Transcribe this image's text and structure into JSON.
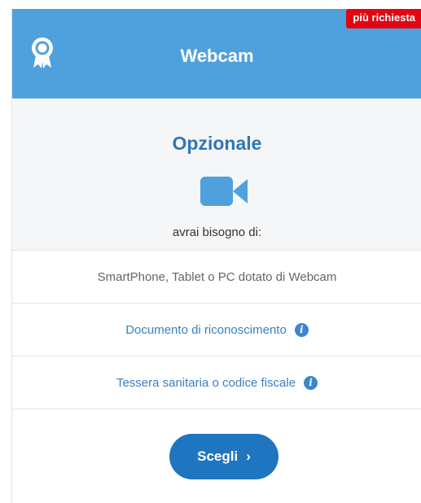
{
  "header": {
    "title": "Webcam",
    "badge": "più richiesta",
    "icon": "award-icon",
    "color": "#4fa1dd"
  },
  "tier": {
    "title": "Opzionale",
    "icon": "video-camera-icon",
    "need_text": "avrai bisogno di:"
  },
  "requirements": [
    {
      "label": "SmartPhone, Tablet o PC dotato di Webcam",
      "has_info": false
    },
    {
      "label": "Documento di riconoscimento",
      "has_info": true
    },
    {
      "label": "Tessera sanitaria o codice fiscale",
      "has_info": true
    }
  ],
  "info_icon_glyph": "i",
  "action": {
    "label": "Scegli",
    "chevron": "›",
    "color": "#1e75c0"
  }
}
